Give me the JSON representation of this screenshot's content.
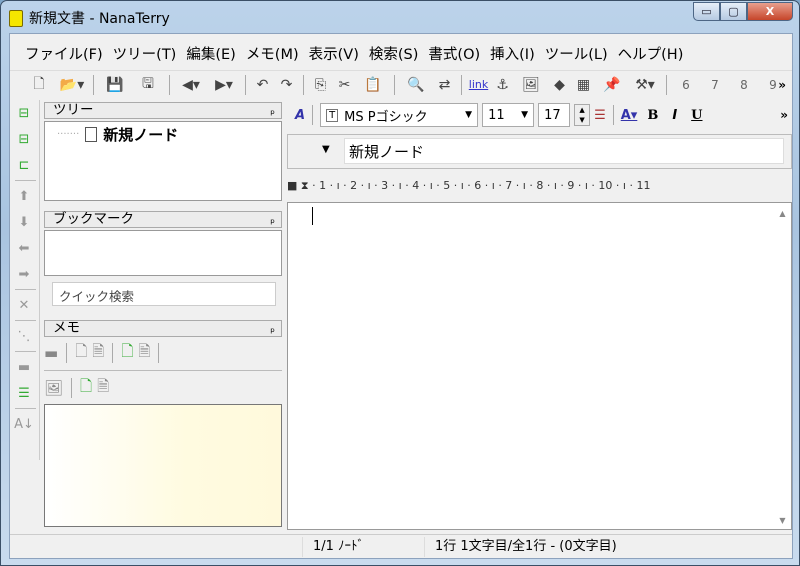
{
  "window": {
    "title": "新規文書 - NanaTerry",
    "minimize": "▭",
    "maximize": "▢",
    "close": "X"
  },
  "menu": [
    "ファイル(F)",
    "ツリー(T)",
    "編集(E)",
    "メモ(M)",
    "表示(V)",
    "検索(S)",
    "書式(O)",
    "挿入(I)",
    "ツール(L)",
    "ヘルプ(H)"
  ],
  "toolbar": {
    "items": [
      {
        "name": "new-document-icon",
        "g": "🗋"
      },
      {
        "name": "open-folder-icon",
        "g": "📂▾"
      },
      {
        "sep": true
      },
      {
        "name": "save-icon",
        "g": "💾"
      },
      {
        "name": "save-all-icon",
        "g": "🖫"
      },
      {
        "sep": true
      },
      {
        "name": "back-icon",
        "g": "◀▾"
      },
      {
        "name": "forward-icon",
        "g": "▶▾"
      },
      {
        "sep": true
      },
      {
        "name": "undo-icon",
        "g": "↶"
      },
      {
        "name": "redo-icon",
        "g": "↷"
      },
      {
        "sep": true
      },
      {
        "name": "copy-icon",
        "g": "⎘"
      },
      {
        "name": "cut-icon",
        "g": "✂"
      },
      {
        "name": "paste-icon",
        "g": "📋"
      },
      {
        "sep": true
      },
      {
        "name": "find-icon",
        "g": "🔍"
      },
      {
        "name": "replace-icon",
        "g": "⇄"
      },
      {
        "sep": true
      },
      {
        "name": "link-icon",
        "g": "link"
      },
      {
        "name": "anchor-icon",
        "g": "⚓"
      },
      {
        "name": "image-icon",
        "g": "🖼"
      },
      {
        "name": "shapes-icon",
        "g": "◆"
      },
      {
        "name": "table-icon",
        "g": "▦"
      },
      {
        "name": "pin-icon",
        "g": "📌"
      },
      {
        "name": "tools-icon",
        "g": "⚒▾"
      },
      {
        "sep": true
      }
    ],
    "numbers": [
      "6",
      "7",
      "8",
      "9"
    ],
    "more": "»"
  },
  "left_strip": [
    {
      "name": "tree-add-sibling-icon",
      "g": "⊟"
    },
    {
      "name": "tree-add-child-icon",
      "g": "⊟"
    },
    {
      "name": "tree-add-sub-icon",
      "g": "⊏"
    },
    {
      "sep": true
    },
    {
      "name": "move-up-icon",
      "g": "⬆",
      "gray": true
    },
    {
      "name": "move-down-icon",
      "g": "⬇",
      "gray": true
    },
    {
      "name": "move-left-icon",
      "g": "⬅",
      "gray": true
    },
    {
      "name": "move-right-icon",
      "g": "➡",
      "gray": true
    },
    {
      "sep": true
    },
    {
      "name": "delete-icon",
      "g": "✕",
      "gray": true
    },
    {
      "sep": true
    },
    {
      "name": "tree-expand-icon",
      "g": "⋱",
      "gray": true
    },
    {
      "sep": true
    },
    {
      "name": "collapse-icon",
      "g": "▬",
      "gray": true
    },
    {
      "name": "expand-icon",
      "g": "☰"
    },
    {
      "sep": true
    },
    {
      "name": "sort-az-icon",
      "g": "A↓",
      "gray": true
    }
  ],
  "tree": {
    "header": "ツリー",
    "pin": "ₚ",
    "node": "新規ノード"
  },
  "bookmark": {
    "header": "ブックマーク",
    "pin": "ₚ",
    "search_placeholder": "クイック検索"
  },
  "memo": {
    "header": "メモ",
    "pin": "ₚ"
  },
  "format": {
    "font": "MS Pゴシック",
    "size": "11",
    "line_height": "17",
    "more": "»"
  },
  "node_title": "新規ノード",
  "ruler": "■ ⧗ · 1 · ı · 2 · ı · 3 · ı · 4 · ı · 5 · ı · 6 · ı · 7 · ı · 8 · ı · 9 · ı · 10 · ı · 11",
  "status": {
    "nodes": "1/1 ﾉｰﾄﾞ",
    "position": "1行 1文字目/全1行 -  (0文字目)"
  }
}
